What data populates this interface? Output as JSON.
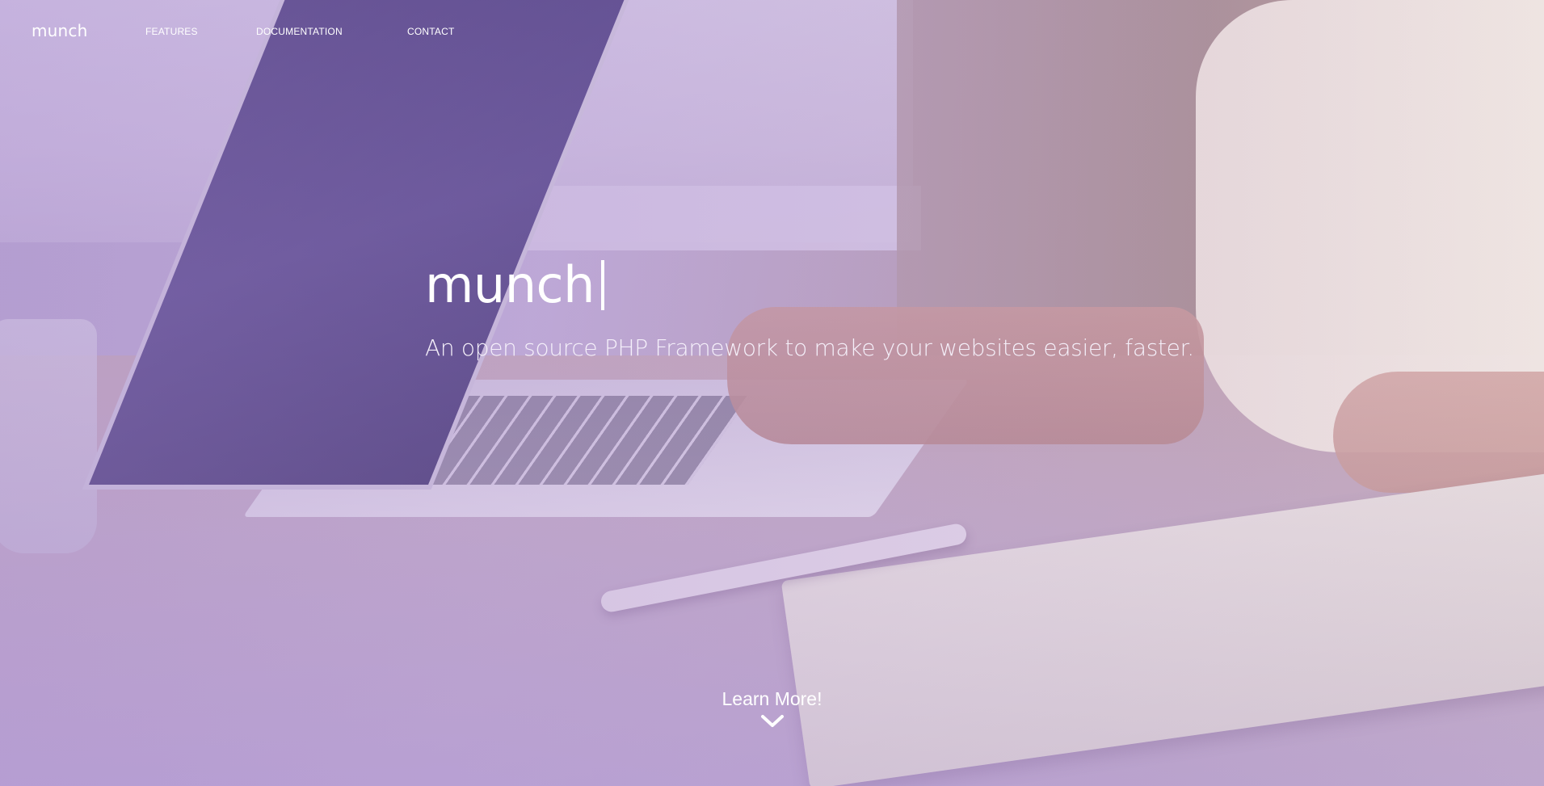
{
  "nav": {
    "brand": "munch",
    "links": [
      {
        "label": "FEATURES"
      },
      {
        "label": "DOCUMENTATION"
      },
      {
        "label": "CONTACT"
      }
    ]
  },
  "hero": {
    "title": "munch",
    "subtitle": "An open source PHP Framework to make your websites easier, faster.",
    "cta_label": "Learn More!",
    "cta_icon": "chevron-down-icon"
  },
  "colors": {
    "overlay_accent": "#b8a6cf",
    "text": "#ffffff"
  }
}
